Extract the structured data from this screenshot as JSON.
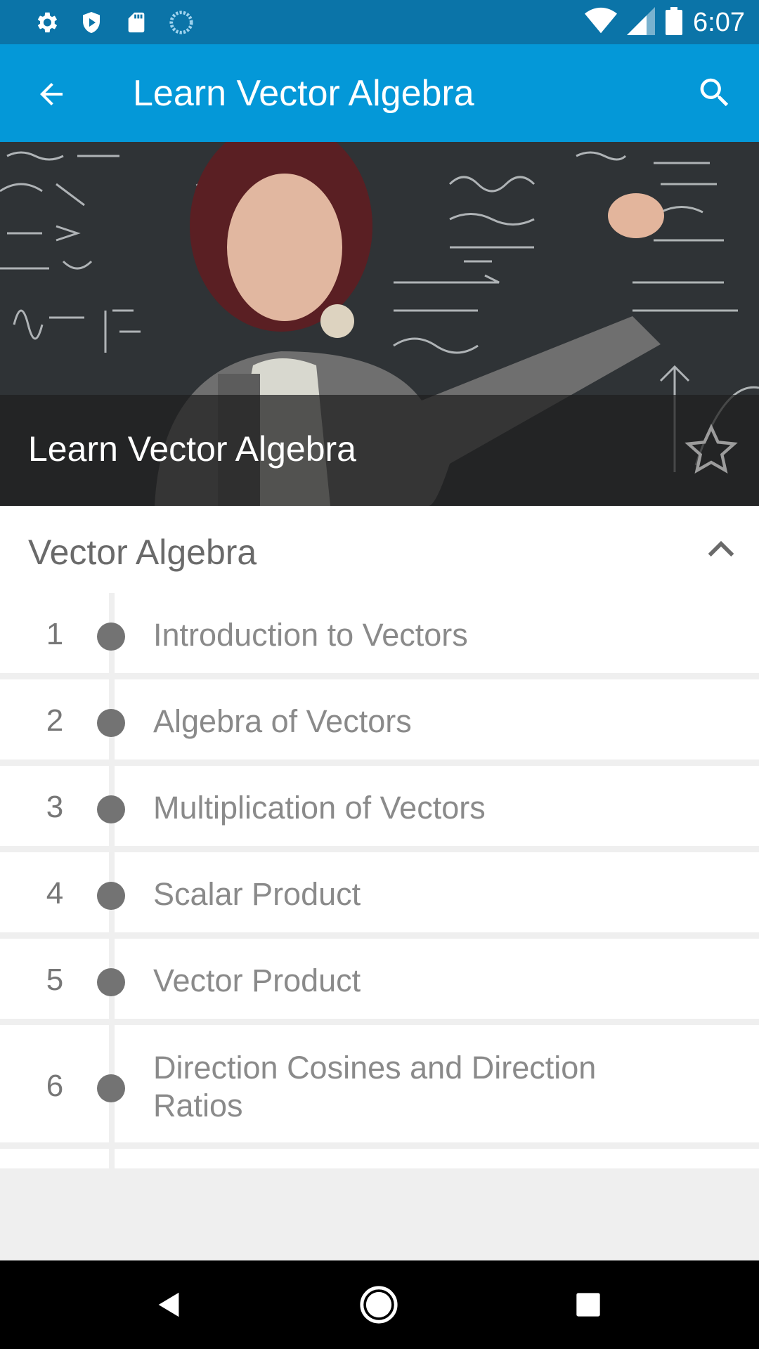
{
  "status_bar": {
    "time": "6:07",
    "left_icons": [
      "gear-icon",
      "shield-icon",
      "sd-card-icon",
      "sync-icon"
    ],
    "right_icons": [
      "wifi-icon",
      "signal-icon",
      "battery-icon"
    ]
  },
  "app_bar": {
    "title": "Learn Vector Algebra",
    "back_icon": "arrow-back-icon",
    "search_icon": "search-icon",
    "background": "#0498d8"
  },
  "hero": {
    "title": "Learn Vector Algebra",
    "favorite_icon": "star-outline-icon"
  },
  "section": {
    "title": "Vector Algebra",
    "expanded_icon": "chevron-up-icon"
  },
  "topics": [
    {
      "number": "1",
      "label": "Introduction to Vectors"
    },
    {
      "number": "2",
      "label": "Algebra of Vectors"
    },
    {
      "number": "3",
      "label": "Multiplication of Vectors"
    },
    {
      "number": "4",
      "label": "Scalar Product"
    },
    {
      "number": "5",
      "label": "Vector Product"
    },
    {
      "number": "6",
      "label": "Direction Cosines and Direction Ratios"
    }
  ],
  "nav_bar": {
    "icons": [
      "nav-back-icon",
      "nav-home-icon",
      "nav-recents-icon"
    ]
  }
}
